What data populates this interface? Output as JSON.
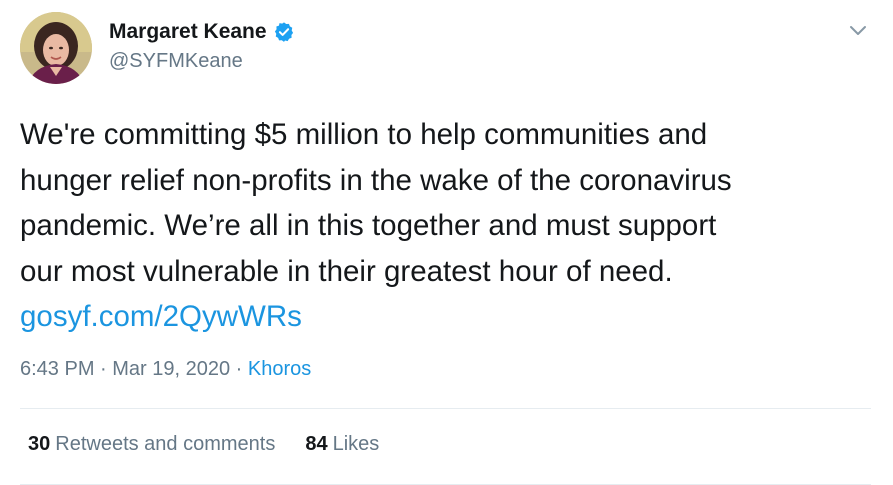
{
  "author": {
    "display_name": "Margaret Keane",
    "handle": "@SYFMKeane",
    "verified": true
  },
  "tweet": {
    "lines": [
      "We're committing $5 million to help communities and",
      "hunger relief non-profits in the wake of the coronavirus",
      "pandemic. We’re all in this together and must support",
      "our most vulnerable in their greatest hour of need."
    ],
    "link": "gosyf.com/2QywWRs"
  },
  "meta": {
    "time": "6:43 PM",
    "separator": " · ",
    "date": "Mar 19, 2020",
    "source": "Khoros"
  },
  "stats": {
    "retweets_count": "30",
    "retweets_label": "Retweets and comments",
    "likes_count": "84",
    "likes_label": "Likes"
  },
  "icons": {
    "verified": "verified-badge-icon",
    "menu": "chevron-down-icon"
  },
  "colors": {
    "link": "#1b95e0",
    "secondary_text": "#657786",
    "primary_text": "#14171a",
    "verified_badge": "#1da1f2"
  }
}
